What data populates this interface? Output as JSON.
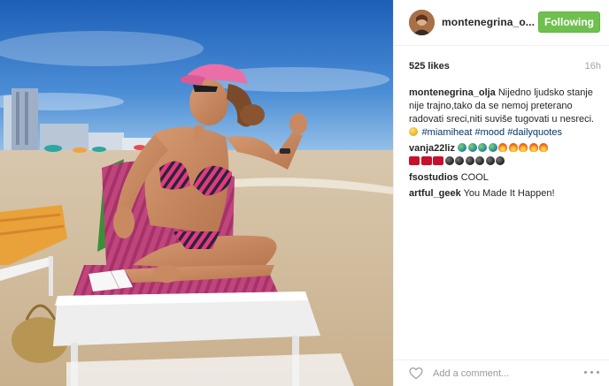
{
  "post": {
    "username": "montenegrina_o...",
    "follow_label": "Following",
    "likes": "525 likes",
    "age": "16h"
  },
  "comments": [
    {
      "user": "montenegrina_olja",
      "text": "Nijedno ljudsko stanje nije trajno,tako da se nemoj preterano radovati sreci,niti suviše tugovati u nesreci.",
      "hashtags": [
        "#miamiheat",
        "#mood",
        "#dailyquotes"
      ]
    },
    {
      "user": "vanja22liz",
      "text": ""
    },
    {
      "user": "fsostudios",
      "text": "COOL"
    },
    {
      "user": "artful_geek",
      "text": "You Made It Happen!"
    }
  ],
  "composer": {
    "placeholder": "Add a comment..."
  },
  "colors": {
    "follow_green": "#70c050",
    "hashtag_blue": "#003569",
    "muted_gray": "#a5a5a5"
  },
  "icons": [
    "heart-icon",
    "more-options-icon",
    "profile-avatar"
  ]
}
